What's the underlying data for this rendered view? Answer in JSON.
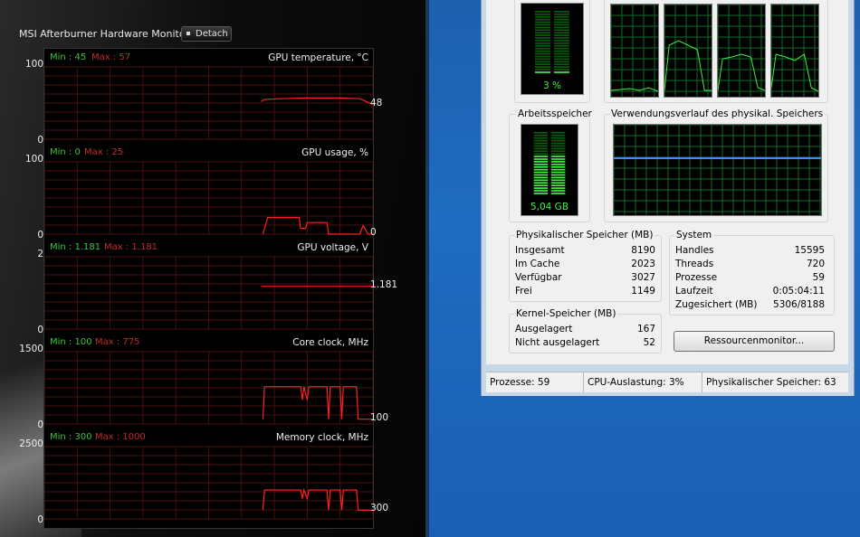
{
  "afterburner": {
    "title": "MSI Afterburner Hardware Monitor",
    "detach_label": "Detach",
    "colors": {
      "min": "#39c439",
      "max": "#c22a2a",
      "grid": "#4a0f0f",
      "line": "#ff2020"
    },
    "panels": [
      {
        "name": "GPU temperature, °C",
        "min": "Min : 45",
        "max": "Max : 57",
        "top": "100",
        "bottom": "0",
        "current": "48",
        "scale_max": 100,
        "series": [
          [
            0.6,
            null
          ],
          [
            0.66,
            52
          ],
          [
            0.67,
            55
          ],
          [
            0.72,
            56
          ],
          [
            0.8,
            57
          ],
          [
            0.9,
            57
          ],
          [
            0.96,
            56
          ],
          [
            0.98,
            52
          ],
          [
            1.0,
            48
          ]
        ]
      },
      {
        "name": "GPU usage, %",
        "min": "Min : 0",
        "max": "Max : 25",
        "top": "100",
        "bottom": "0",
        "current": "0",
        "scale_max": 100,
        "series": [
          [
            0.6,
            null
          ],
          [
            0.665,
            0
          ],
          [
            0.68,
            23
          ],
          [
            0.775,
            23
          ],
          [
            0.78,
            8
          ],
          [
            0.795,
            8
          ],
          [
            0.8,
            16
          ],
          [
            0.86,
            16
          ],
          [
            0.865,
            0
          ],
          [
            0.96,
            0
          ],
          [
            0.97,
            12
          ],
          [
            0.985,
            0
          ],
          [
            1.0,
            0
          ]
        ]
      },
      {
        "name": "GPU voltage, V",
        "min": "Min : 1.181",
        "max": "Max : 1.181",
        "top": "2",
        "bottom": "0",
        "current": "1.181",
        "scale_max": 2,
        "series": [
          [
            0.6,
            null
          ],
          [
            0.66,
            1.181
          ],
          [
            1.0,
            1.181
          ]
        ]
      },
      {
        "name": "Core clock, MHz",
        "min": "Min : 100",
        "max": "Max : 775",
        "top": "1500",
        "bottom": "0",
        "current": "100",
        "scale_max": 1500,
        "series": [
          [
            0.6,
            null
          ],
          [
            0.665,
            100
          ],
          [
            0.67,
            775
          ],
          [
            0.78,
            775
          ],
          [
            0.785,
            500
          ],
          [
            0.79,
            775
          ],
          [
            0.8,
            500
          ],
          [
            0.805,
            775
          ],
          [
            0.86,
            775
          ],
          [
            0.865,
            100
          ],
          [
            0.87,
            775
          ],
          [
            0.9,
            775
          ],
          [
            0.905,
            100
          ],
          [
            0.91,
            775
          ],
          [
            0.95,
            775
          ],
          [
            0.955,
            100
          ],
          [
            1.0,
            100
          ]
        ]
      },
      {
        "name": "Memory clock, MHz",
        "min": "Min : 300",
        "max": "Max : 1000",
        "top": "2500",
        "bottom": "0",
        "current": "300",
        "scale_max": 2500,
        "series": [
          [
            0.6,
            null
          ],
          [
            0.665,
            300
          ],
          [
            0.67,
            1000
          ],
          [
            0.78,
            1000
          ],
          [
            0.785,
            700
          ],
          [
            0.79,
            1000
          ],
          [
            0.8,
            700
          ],
          [
            0.805,
            1000
          ],
          [
            0.86,
            1000
          ],
          [
            0.865,
            300
          ],
          [
            0.87,
            1000
          ],
          [
            0.9,
            1000
          ],
          [
            0.905,
            300
          ],
          [
            0.91,
            1000
          ],
          [
            0.95,
            1000
          ],
          [
            0.955,
            300
          ],
          [
            1.0,
            300
          ]
        ]
      }
    ]
  },
  "taskmanager": {
    "cpu_meter_label": "3 %",
    "cpu_percent": 3,
    "memory_group_label": "Arbeitsspeicher",
    "memory_meter_label": "5,04 GB",
    "memory_fraction": 0.62,
    "history_group_label": "Verwendungsverlauf des physikal. Speichers",
    "physical": {
      "label": "Physikalischer Speicher (MB)",
      "rows": [
        {
          "k": "Insgesamt",
          "v": "8190"
        },
        {
          "k": "Im Cache",
          "v": "2023"
        },
        {
          "k": "Verfügbar",
          "v": "3027"
        },
        {
          "k": "Frei",
          "v": "1149"
        }
      ]
    },
    "kernel": {
      "label": "Kernel-Speicher (MB)",
      "rows": [
        {
          "k": "Ausgelagert",
          "v": "167"
        },
        {
          "k": "Nicht ausgelagert",
          "v": "52"
        }
      ]
    },
    "system": {
      "label": "System",
      "rows": [
        {
          "k": "Handles",
          "v": "15595"
        },
        {
          "k": "Threads",
          "v": "720"
        },
        {
          "k": "Prozesse",
          "v": "59"
        },
        {
          "k": "Laufzeit",
          "v": "0:05:04:11"
        },
        {
          "k": "Zugesichert (MB)",
          "v": "5306/8188"
        }
      ]
    },
    "resource_monitor_button": "Ressourcenmonitor...",
    "status": {
      "processes": "Prozesse: 59",
      "cpu": "CPU-Auslastung: 3%",
      "memory": "Physikalischer Speicher: 63"
    }
  }
}
